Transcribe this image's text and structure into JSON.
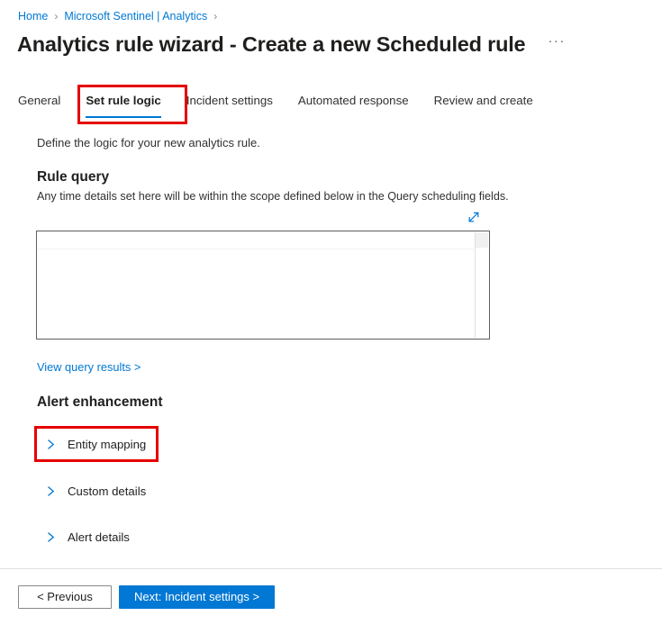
{
  "breadcrumb": {
    "items": [
      {
        "label": "Home",
        "separator": "›"
      },
      {
        "label": "Microsoft Sentinel | Analytics",
        "separator": "›"
      }
    ]
  },
  "header": {
    "title": "Analytics rule wizard - Create a new Scheduled rule",
    "more_menu": "···"
  },
  "tabs": [
    {
      "label": "General",
      "active": false
    },
    {
      "label": "Set rule logic",
      "active": true
    },
    {
      "label": "Incident settings",
      "active": false
    },
    {
      "label": "Automated response",
      "active": false
    },
    {
      "label": "Review and create",
      "active": false
    }
  ],
  "main": {
    "intro": "Define the logic for your new analytics rule.",
    "rule_query": {
      "heading": "Rule query",
      "subtext": "Any time details set here will be within the scope defined below in the Query scheduling fields.",
      "expand_icon": "expand-diagonal-icon",
      "editor_value": "",
      "editor_placeholder": ""
    },
    "view_query_results_link": "View query results >",
    "alert_enhancement": {
      "heading": "Alert enhancement",
      "sections": [
        {
          "label": "Entity mapping",
          "expanded": false,
          "highlighted": true
        },
        {
          "label": "Custom details",
          "expanded": false,
          "highlighted": false
        },
        {
          "label": "Alert details",
          "expanded": false,
          "highlighted": false
        }
      ]
    }
  },
  "footer": {
    "previous_label": "< Previous",
    "next_label": "Next: Incident settings >"
  },
  "colors": {
    "accent_blue": "#0078d4",
    "link_blue": "#0078d4",
    "annotation_red": "#e60000",
    "text_primary": "#201f1e",
    "text_secondary": "#323130",
    "border_gray": "#605e5c"
  }
}
